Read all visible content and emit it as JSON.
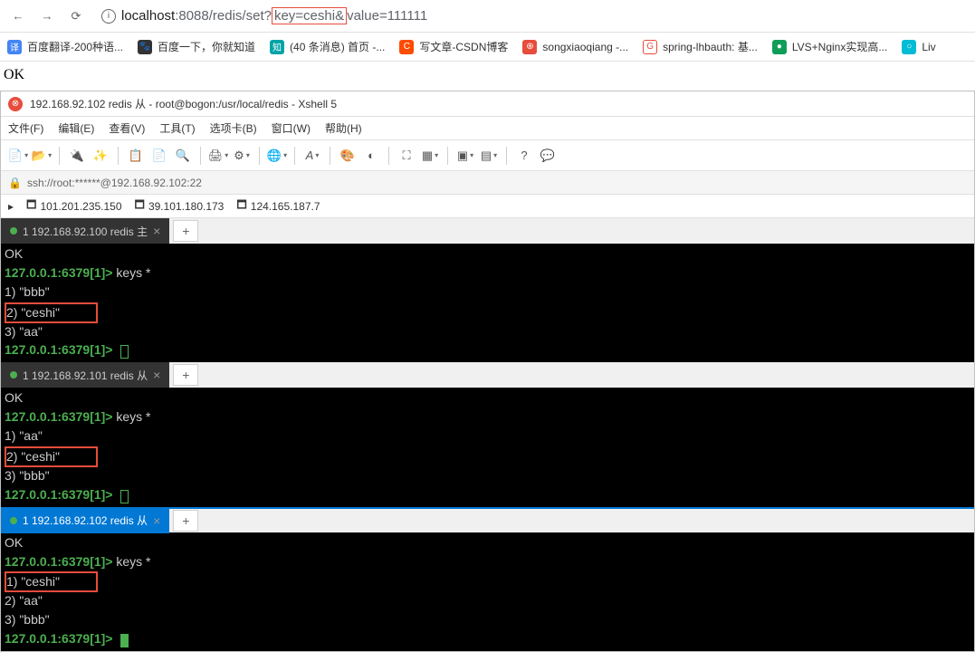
{
  "browser": {
    "url_host": "localhost",
    "url_port": ":8088",
    "url_path_pre": "/redis/set?",
    "url_highlight": "key=ceshi&",
    "url_path_post": "value=111111"
  },
  "bookmarks": [
    {
      "label": "百度翻译-200种语..."
    },
    {
      "label": "百度一下，你就知道"
    },
    {
      "label": "(40 条消息) 首页 -..."
    },
    {
      "label": "写文章-CSDN博客"
    },
    {
      "label": "songxiaoqiang -..."
    },
    {
      "label": "spring-lhbauth: 基..."
    },
    {
      "label": "LVS+Nginx实现高..."
    },
    {
      "label": "Liv"
    }
  ],
  "page_response": "OK",
  "xshell": {
    "title": "192.168.92.102   redis 从 - root@bogon:/usr/local/redis - Xshell 5",
    "menus": {
      "file": "文件(F)",
      "edit": "编辑(E)",
      "view": "查看(V)",
      "tools": "工具(T)",
      "tabs": "选项卡(B)",
      "window": "窗口(W)",
      "help": "帮助(H)"
    },
    "ssh_url": "ssh://root:******@192.168.92.102:22",
    "sessions": [
      "101.201.235.150",
      "39.101.180.173",
      "124.165.187.7"
    ]
  },
  "panes": [
    {
      "tab_label": "1 192.168.92.100 redis 主",
      "tab_style": "dark",
      "lines": {
        "l0": "OK",
        "l1_prompt": "127.0.0.1:6379[1]>",
        "l1_cmd": " keys *",
        "l2": "1) \"bbb\"",
        "l3": "2) \"ceshi\"",
        "l4": "3) \"aa\"",
        "l5_prompt": "127.0.0.1:6379[1]>"
      }
    },
    {
      "tab_label": "1 192.168.92.101 redis 从",
      "tab_style": "dark",
      "lines": {
        "l0": "OK",
        "l1_prompt": "127.0.0.1:6379[1]>",
        "l1_cmd": " keys *",
        "l2": "1) \"aa\"",
        "l3": "2) \"ceshi\"",
        "l4": "3) \"bbb\"",
        "l5_prompt": "127.0.0.1:6379[1]>"
      }
    },
    {
      "tab_label": "1 192.168.92.102  redis 从",
      "tab_style": "blue",
      "lines": {
        "l0": "OK",
        "l1_prompt": "127.0.0.1:6379[1]>",
        "l1_cmd": " keys *",
        "l2": "1) \"ceshi\"",
        "l3": "2) \"aa\"",
        "l4": "3) \"bbb\"",
        "l5_prompt": "127.0.0.1:6379[1]>"
      }
    }
  ]
}
